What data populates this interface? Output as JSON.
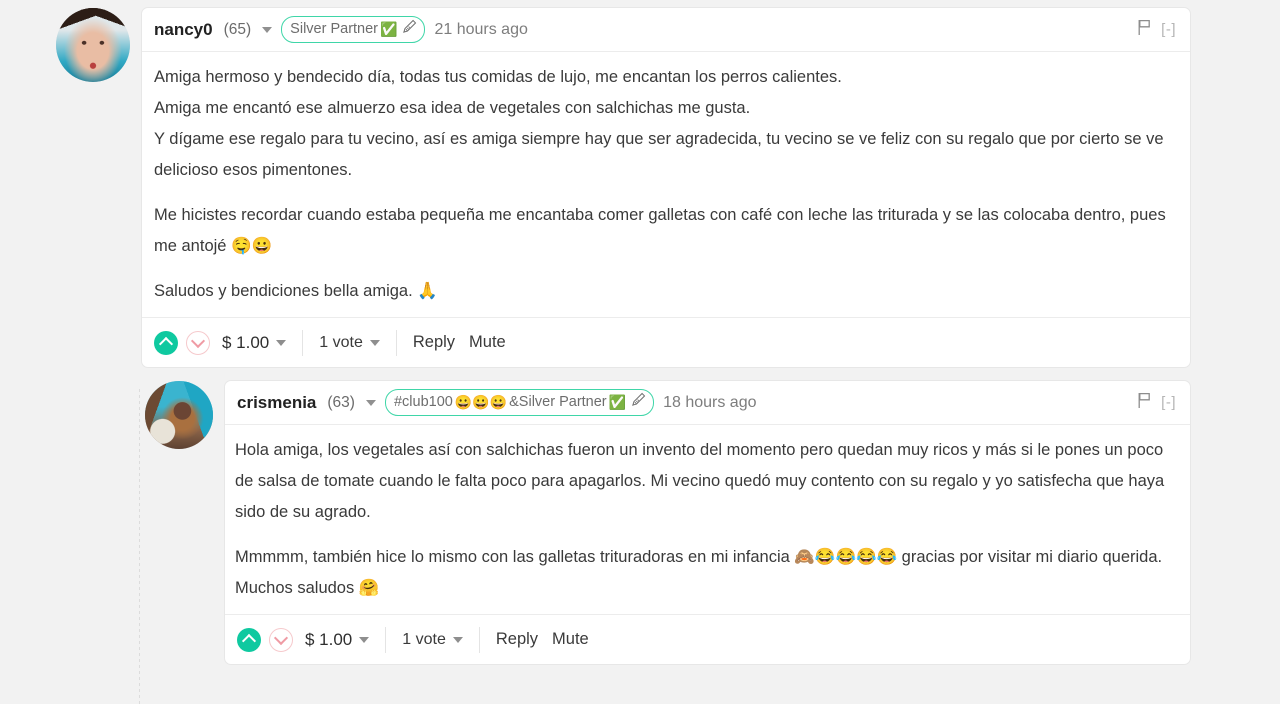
{
  "theme": {
    "page_bg": "#f2f2f2",
    "card_bg": "#ffffff",
    "badge_border": "#3fd6a8",
    "upvote": "#0fc9a0",
    "downvote_border": "#f6c9cc"
  },
  "comments": [
    {
      "author": "nancy0",
      "reputation": "(65)",
      "badge": {
        "text": "Silver Partner",
        "check_icon": "✅",
        "pen_icon": "✎"
      },
      "timestamp": "21 hours ago",
      "flag_icon": "flag-icon",
      "collapse": "[-]",
      "paragraphs": [
        "Amiga hermoso y bendecido día, todas tus comidas de lujo, me encantan los perros calientes.",
        "Amiga me encantó ese almuerzo esa idea de vegetales con salchichas me gusta.",
        "Y dígame ese regalo para tu vecino, así es amiga siempre hay que ser agradecida, tu vecino se ve feliz con su regalo que por cierto se ve delicioso esos pimentones.",
        "Me hicistes recordar cuando estaba pequeña me encantaba comer galletas con café con leche las triturada y se las colocaba dentro, pues me antojé 🤤😀",
        "Saludos y bendiciones bella amiga. 🙏"
      ],
      "footer": {
        "upvote_icon": "chevron-up-icon",
        "downvote_icon": "chevron-down-icon",
        "payout": "$ 1.00",
        "votes": "1 vote",
        "reply_label": "Reply",
        "mute_label": "Mute"
      }
    },
    {
      "author": "crismenia",
      "reputation": "(63)",
      "badge": {
        "text_before": "#club100",
        "emojis": "😀😀😀",
        "text_after": "&Silver Partner",
        "check_icon": "✅",
        "pen_icon": "✎"
      },
      "timestamp": "18 hours ago",
      "flag_icon": "flag-icon",
      "collapse": "[-]",
      "paragraphs": [
        "Hola amiga, los vegetales así con salchichas fueron un invento del momento pero quedan muy ricos y más si le pones un poco de salsa de tomate cuando le falta poco para apagarlos. Mi vecino quedó muy contento con su regalo y yo satisfecha que haya sido de su agrado.",
        "Mmmmm, también hice lo mismo con las galletas trituradoras en mi infancia 🙈😂😂😂😂 gracias por visitar mi diario querida. Muchos saludos 🤗"
      ],
      "footer": {
        "upvote_icon": "chevron-up-icon",
        "downvote_icon": "chevron-down-icon",
        "payout": "$ 1.00",
        "votes": "1 vote",
        "reply_label": "Reply",
        "mute_label": "Mute"
      }
    }
  ]
}
